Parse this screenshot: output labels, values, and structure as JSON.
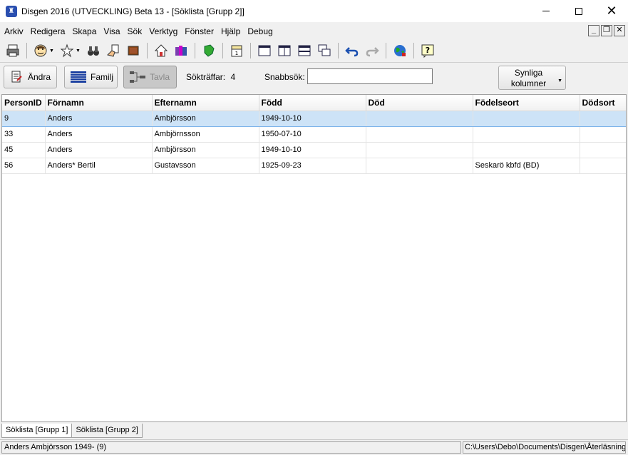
{
  "window": {
    "title": "Disgen 2016 (UTVECKLING) Beta 13 - [Söklista [Grupp 2]]"
  },
  "menu": [
    "Arkiv",
    "Redigera",
    "Skapa",
    "Visa",
    "Sök",
    "Verktyg",
    "Fönster",
    "Hjälp",
    "Debug"
  ],
  "actions": {
    "edit_label": "Ändra",
    "family_label": "Familj",
    "board_label": "Tavla",
    "hits_label": "Sökträffar:",
    "hits_count": "4",
    "quick_search_label": "Snabbsök:",
    "quick_search_value": "",
    "columns_label_1": "Synliga",
    "columns_label_2": "kolumner"
  },
  "table": {
    "columns": [
      "PersonID",
      "Förnamn",
      "Efternamn",
      "Född",
      "Död",
      "Födelseort",
      "Dödsort"
    ],
    "rows": [
      [
        "9",
        "Anders",
        "Ambjörsson",
        "1949-10-10",
        "",
        "",
        ""
      ],
      [
        "33",
        "Anders",
        "Ambjörnsson",
        "1950-07-10",
        "",
        "",
        ""
      ],
      [
        "45",
        "Anders",
        "Ambjörsson",
        "1949-10-10",
        "",
        "",
        ""
      ],
      [
        "56",
        "Anders* Bertil",
        "Gustavsson",
        "1925-09-23",
        "",
        "Seskarö kbfd (BD)",
        ""
      ]
    ]
  },
  "tabs": [
    "Söklista [Grupp 1]",
    "Söklista [Grupp 2]"
  ],
  "status": {
    "left": "Anders Ambjörsson 1949- (9)",
    "right": "C:\\Users\\Debo\\Documents\\Disgen\\Återläsning"
  }
}
